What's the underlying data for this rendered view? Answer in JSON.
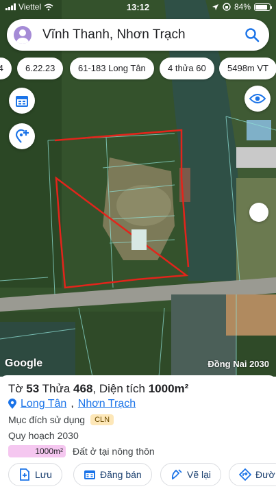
{
  "status": {
    "carrier": "Viettel",
    "time": "13:12",
    "battery": "84%",
    "battery_level": 0.84
  },
  "search": {
    "query": "Vĩnh Thanh, Nhơn Trạch"
  },
  "chips": [
    {
      "label": ".4"
    },
    {
      "label": "6.22.23"
    },
    {
      "label": "61-183 Long Tân"
    },
    {
      "label": "4 thửa 60"
    },
    {
      "label": "5498m VT"
    }
  ],
  "map": {
    "attribution": "Google",
    "plan_label": "Đồng Nai 2030",
    "boundary_color": "#e3241b"
  },
  "parcel": {
    "sheet_prefix": "Tờ",
    "sheet_no": "53",
    "parcel_prefix": "Thửa",
    "parcel_no": "468",
    "area_prefix": ", Diện tích",
    "area": "1000m²",
    "commune": "Long Tân",
    "district": "Nhơn Trạch",
    "purpose_label": "Mục đích sử dụng",
    "purpose_code": "CLN",
    "planning_label": "Quy hoạch 2030",
    "planning_area": "1000m²",
    "planning_use": "Đất ở tại nông thôn"
  },
  "actions": {
    "save": "Lưu",
    "post": "Đăng bán",
    "draw": "Vẽ lại",
    "route": "Đườ"
  },
  "colors": {
    "accent": "#1a73e8",
    "action_text": "#1a3f6f",
    "area_badge": "#f5c7f0",
    "cln_badge": "#fde7b8"
  }
}
